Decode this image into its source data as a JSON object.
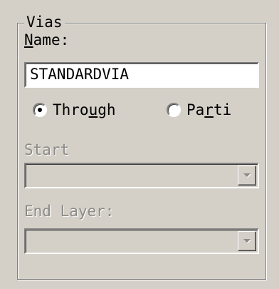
{
  "group": {
    "title": "Vias"
  },
  "name_field": {
    "label_accel": "N",
    "label_rest": "ame:",
    "value": "STANDARDVIA"
  },
  "via_type": {
    "through": {
      "pre": "Thro",
      "accel": "u",
      "post": "gh",
      "selected": true
    },
    "partial": {
      "pre": "Pa",
      "accel": "r",
      "post": "ti",
      "selected": false
    }
  },
  "start_layer": {
    "label": "Start",
    "value": "",
    "enabled": false
  },
  "end_layer": {
    "label": "End Layer:",
    "value": "",
    "enabled": false
  },
  "icons": {
    "combo_arrow": "chevron-down-icon",
    "radio_dot": "radio-selected-icon"
  },
  "colors": {
    "face": "#d4d0c8",
    "disabled_text": "#8c8a86",
    "shadow": "#808080",
    "highlight": "#ffffff"
  }
}
